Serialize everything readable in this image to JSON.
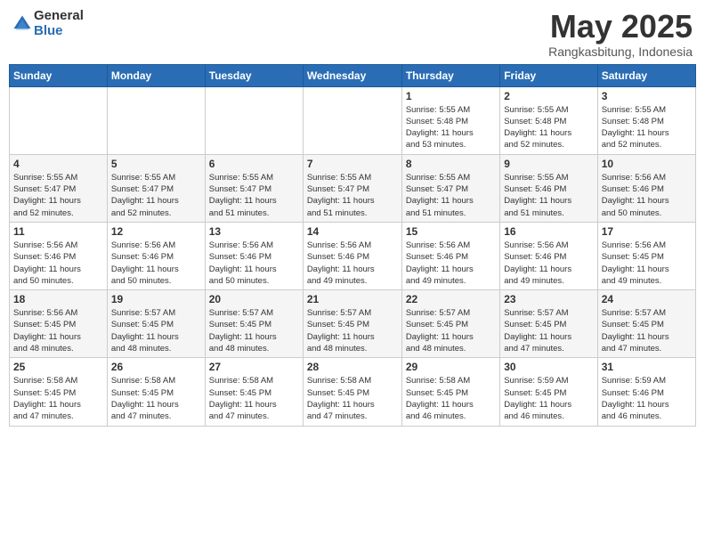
{
  "header": {
    "logo_general": "General",
    "logo_blue": "Blue",
    "title": "May 2025",
    "location": "Rangkasbitung, Indonesia"
  },
  "weekdays": [
    "Sunday",
    "Monday",
    "Tuesday",
    "Wednesday",
    "Thursday",
    "Friday",
    "Saturday"
  ],
  "weeks": [
    [
      {
        "day": "",
        "info": ""
      },
      {
        "day": "",
        "info": ""
      },
      {
        "day": "",
        "info": ""
      },
      {
        "day": "",
        "info": ""
      },
      {
        "day": "1",
        "info": "Sunrise: 5:55 AM\nSunset: 5:48 PM\nDaylight: 11 hours\nand 53 minutes."
      },
      {
        "day": "2",
        "info": "Sunrise: 5:55 AM\nSunset: 5:48 PM\nDaylight: 11 hours\nand 52 minutes."
      },
      {
        "day": "3",
        "info": "Sunrise: 5:55 AM\nSunset: 5:48 PM\nDaylight: 11 hours\nand 52 minutes."
      }
    ],
    [
      {
        "day": "4",
        "info": "Sunrise: 5:55 AM\nSunset: 5:47 PM\nDaylight: 11 hours\nand 52 minutes."
      },
      {
        "day": "5",
        "info": "Sunrise: 5:55 AM\nSunset: 5:47 PM\nDaylight: 11 hours\nand 52 minutes."
      },
      {
        "day": "6",
        "info": "Sunrise: 5:55 AM\nSunset: 5:47 PM\nDaylight: 11 hours\nand 51 minutes."
      },
      {
        "day": "7",
        "info": "Sunrise: 5:55 AM\nSunset: 5:47 PM\nDaylight: 11 hours\nand 51 minutes."
      },
      {
        "day": "8",
        "info": "Sunrise: 5:55 AM\nSunset: 5:47 PM\nDaylight: 11 hours\nand 51 minutes."
      },
      {
        "day": "9",
        "info": "Sunrise: 5:55 AM\nSunset: 5:46 PM\nDaylight: 11 hours\nand 51 minutes."
      },
      {
        "day": "10",
        "info": "Sunrise: 5:56 AM\nSunset: 5:46 PM\nDaylight: 11 hours\nand 50 minutes."
      }
    ],
    [
      {
        "day": "11",
        "info": "Sunrise: 5:56 AM\nSunset: 5:46 PM\nDaylight: 11 hours\nand 50 minutes."
      },
      {
        "day": "12",
        "info": "Sunrise: 5:56 AM\nSunset: 5:46 PM\nDaylight: 11 hours\nand 50 minutes."
      },
      {
        "day": "13",
        "info": "Sunrise: 5:56 AM\nSunset: 5:46 PM\nDaylight: 11 hours\nand 50 minutes."
      },
      {
        "day": "14",
        "info": "Sunrise: 5:56 AM\nSunset: 5:46 PM\nDaylight: 11 hours\nand 49 minutes."
      },
      {
        "day": "15",
        "info": "Sunrise: 5:56 AM\nSunset: 5:46 PM\nDaylight: 11 hours\nand 49 minutes."
      },
      {
        "day": "16",
        "info": "Sunrise: 5:56 AM\nSunset: 5:46 PM\nDaylight: 11 hours\nand 49 minutes."
      },
      {
        "day": "17",
        "info": "Sunrise: 5:56 AM\nSunset: 5:45 PM\nDaylight: 11 hours\nand 49 minutes."
      }
    ],
    [
      {
        "day": "18",
        "info": "Sunrise: 5:56 AM\nSunset: 5:45 PM\nDaylight: 11 hours\nand 48 minutes."
      },
      {
        "day": "19",
        "info": "Sunrise: 5:57 AM\nSunset: 5:45 PM\nDaylight: 11 hours\nand 48 minutes."
      },
      {
        "day": "20",
        "info": "Sunrise: 5:57 AM\nSunset: 5:45 PM\nDaylight: 11 hours\nand 48 minutes."
      },
      {
        "day": "21",
        "info": "Sunrise: 5:57 AM\nSunset: 5:45 PM\nDaylight: 11 hours\nand 48 minutes."
      },
      {
        "day": "22",
        "info": "Sunrise: 5:57 AM\nSunset: 5:45 PM\nDaylight: 11 hours\nand 48 minutes."
      },
      {
        "day": "23",
        "info": "Sunrise: 5:57 AM\nSunset: 5:45 PM\nDaylight: 11 hours\nand 47 minutes."
      },
      {
        "day": "24",
        "info": "Sunrise: 5:57 AM\nSunset: 5:45 PM\nDaylight: 11 hours\nand 47 minutes."
      }
    ],
    [
      {
        "day": "25",
        "info": "Sunrise: 5:58 AM\nSunset: 5:45 PM\nDaylight: 11 hours\nand 47 minutes."
      },
      {
        "day": "26",
        "info": "Sunrise: 5:58 AM\nSunset: 5:45 PM\nDaylight: 11 hours\nand 47 minutes."
      },
      {
        "day": "27",
        "info": "Sunrise: 5:58 AM\nSunset: 5:45 PM\nDaylight: 11 hours\nand 47 minutes."
      },
      {
        "day": "28",
        "info": "Sunrise: 5:58 AM\nSunset: 5:45 PM\nDaylight: 11 hours\nand 47 minutes."
      },
      {
        "day": "29",
        "info": "Sunrise: 5:58 AM\nSunset: 5:45 PM\nDaylight: 11 hours\nand 46 minutes."
      },
      {
        "day": "30",
        "info": "Sunrise: 5:59 AM\nSunset: 5:45 PM\nDaylight: 11 hours\nand 46 minutes."
      },
      {
        "day": "31",
        "info": "Sunrise: 5:59 AM\nSunset: 5:46 PM\nDaylight: 11 hours\nand 46 minutes."
      }
    ]
  ]
}
